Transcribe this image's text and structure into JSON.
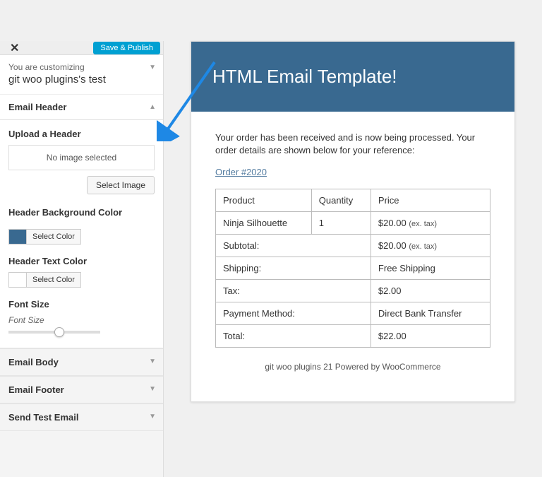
{
  "topbar": {
    "save_label": "Save & Publish"
  },
  "customizing": {
    "label": "You are customizing",
    "site": "git woo plugins's test"
  },
  "active_panel": "Email Header",
  "upload": {
    "heading": "Upload a Header",
    "no_image": "No image selected",
    "button": "Select Image"
  },
  "bg_color": {
    "heading": "Header Background Color",
    "button": "Select Color",
    "value": "#396990"
  },
  "text_color": {
    "heading": "Header Text Color",
    "button": "Select Color",
    "value": "#ffffff"
  },
  "font_size": {
    "heading": "Font Size",
    "sub": "Font Size"
  },
  "panels": {
    "body": "Email Body",
    "footer": "Email Footer",
    "send": "Send Test Email"
  },
  "email": {
    "header_text": "HTML Email Template!",
    "intro": "Your order has been received and is now being processed. Your order details are shown below for your reference:",
    "order_link": "Order #2020",
    "cols": {
      "product": "Product",
      "qty": "Quantity",
      "price": "Price"
    },
    "item": {
      "name": "Ninja Silhouette",
      "qty": "1",
      "price": "$20.00",
      "ex": "(ex. tax)"
    },
    "subtotal_label": "Subtotal:",
    "subtotal_val": "$20.00",
    "shipping_label": "Shipping:",
    "shipping_val": "Free Shipping",
    "tax_label": "Tax:",
    "tax_val": "$2.00",
    "payment_label": "Payment Method:",
    "payment_val": "Direct Bank Transfer",
    "total_label": "Total:",
    "total_val": "$22.00",
    "footer": "git woo plugins 21 Powered by WooCommerce"
  }
}
